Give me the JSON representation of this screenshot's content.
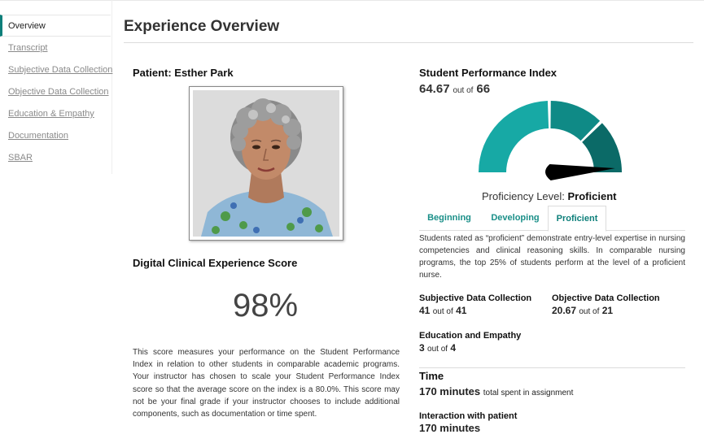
{
  "sidebar": {
    "items": [
      {
        "label": "Overview",
        "active": true
      },
      {
        "label": "Transcript",
        "active": false
      },
      {
        "label": "Subjective Data Collection",
        "active": false
      },
      {
        "label": "Objective Data Collection",
        "active": false
      },
      {
        "label": "Education & Empathy",
        "active": false
      },
      {
        "label": "Documentation",
        "active": false
      },
      {
        "label": "SBAR",
        "active": false
      }
    ]
  },
  "header": {
    "title": "Experience Overview"
  },
  "patient": {
    "label": "Patient: Esther Park"
  },
  "dce": {
    "label": "Digital Clinical Experience Score",
    "value": "98%",
    "description": "This score measures your performance on the Student Performance Index in relation to other students in comparable academic programs. Your instructor has chosen to scale your Student Performance Index score so that the average score on the index is a 80.0%. This score may not be your final grade if your instructor chooses to include additional components, such as documentation or time spent."
  },
  "spi": {
    "title": "Student Performance Index",
    "score": "64.67",
    "out_of_label": "out of",
    "max": "66",
    "gauge_fraction": 0.98,
    "colors": {
      "beginning": "#17a9a5",
      "developing": "#0f8a86",
      "proficient": "#0b6a67",
      "needle": "#000000"
    }
  },
  "proficiency": {
    "label": "Proficiency Level:",
    "level": "Proficient",
    "tabs": [
      {
        "label": "Beginning",
        "active": false
      },
      {
        "label": "Developing",
        "active": false
      },
      {
        "label": "Proficient",
        "active": true
      }
    ],
    "description": "Students rated as “proficient” demonstrate entry-level expertise in nursing competencies and clinical reasoning skills. In comparable nursing programs, the top 25% of students perform at the level of a proficient nurse."
  },
  "metrics": {
    "subjective": {
      "label": "Subjective Data Collection",
      "value": "41",
      "out_of": "out of",
      "max": "41"
    },
    "objective": {
      "label": "Objective Data Collection",
      "value": "20.67",
      "out_of": "out of",
      "max": "21"
    },
    "education": {
      "label": "Education and Empathy",
      "value": "3",
      "out_of": "out of",
      "max": "4"
    }
  },
  "time": {
    "title": "Time",
    "total_value": "170 minutes",
    "total_suffix": "total spent in assignment",
    "interaction_label": "Interaction with patient",
    "interaction_value": "170 minutes"
  }
}
